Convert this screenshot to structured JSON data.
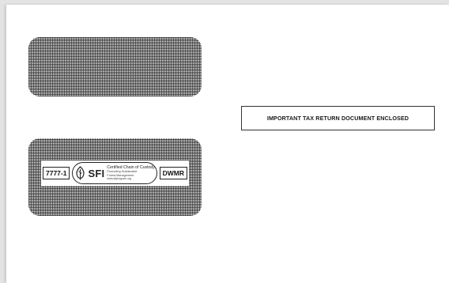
{
  "envelope": {
    "notice_text": "IMPORTANT TAX RETURN DOCUMENT ENCLOSED",
    "left_code": "7777-1",
    "right_code": "DWMR",
    "certification": {
      "logo_text": "SFI",
      "line1": "Certified Chain of Custody",
      "line2": "Promoting Sustainable",
      "line3": "Forest Management",
      "line4": "www.sfiprogram.org"
    }
  },
  "colors": {
    "envelope_bg": "#ffffff",
    "page_bg": "#e3e3e3",
    "security_tint": "#282828"
  }
}
